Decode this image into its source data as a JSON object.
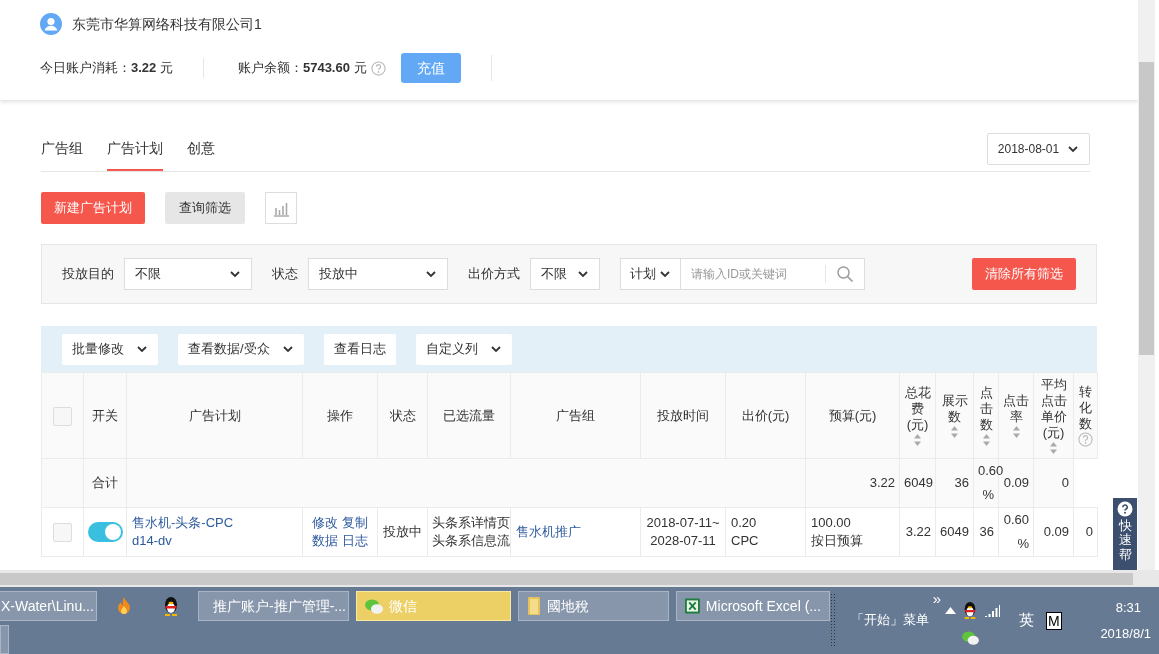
{
  "account": {
    "name": "东莞市华算网络科技有限公司1",
    "stats": [
      {
        "label": "今日账户消耗：",
        "value": "3.22",
        "unit": "元",
        "help": false
      },
      {
        "label": "账户余额：",
        "value": "5743.60",
        "unit": "元",
        "help": true
      }
    ],
    "recharge_button": "充值"
  },
  "tabs": [
    {
      "label": "广告组",
      "selected": false
    },
    {
      "label": "广告计划",
      "selected": true
    },
    {
      "label": "创意",
      "selected": false
    }
  ],
  "date_picker": {
    "value": "2018-08-01"
  },
  "actions": {
    "new_button": "新建广告计划",
    "filter_button": "查询筛选"
  },
  "filters": {
    "selects": [
      {
        "label": "投放目的",
        "value": "不限"
      },
      {
        "label": "状态",
        "value": "投放中"
      },
      {
        "label": "出价方式",
        "value": "不限"
      }
    ],
    "search": {
      "scope": "计划",
      "placeholder": "请输入ID或关键词"
    },
    "clear_button": "清除所有筛选"
  },
  "table": {
    "toolbar": [
      {
        "label": "批量修改",
        "dropdown": true
      },
      {
        "label": "查看数据/受众",
        "dropdown": true
      },
      {
        "label": "查看日志",
        "dropdown": false
      },
      {
        "label": "自定义列",
        "dropdown": true
      }
    ],
    "select_all": {
      "checked": false
    },
    "columns": [
      {
        "label": "开关",
        "sortable": false,
        "help": false
      },
      {
        "label": "广告计划",
        "sortable": false,
        "help": false
      },
      {
        "label": "操作",
        "sortable": false,
        "help": false
      },
      {
        "label": "状态",
        "sortable": false,
        "help": false
      },
      {
        "label": "已选流量",
        "sortable": false,
        "help": false
      },
      {
        "label": "广告组",
        "sortable": false,
        "help": false
      },
      {
        "label": "投放时间",
        "sortable": false,
        "help": false
      },
      {
        "label": "出价(元)",
        "sortable": false,
        "help": false
      },
      {
        "label": "预算(元)",
        "sortable": false,
        "help": false
      },
      {
        "label": "总花费(元)",
        "sortable": true,
        "help": false
      },
      {
        "label": "展示数",
        "sortable": true,
        "help": false
      },
      {
        "label": "点击数",
        "sortable": true,
        "help": false
      },
      {
        "label": "点击率",
        "sortable": true,
        "help": false
      },
      {
        "label": "平均点击单价(元)",
        "sortable": true,
        "help": false
      },
      {
        "label": "转化数",
        "sortable": false,
        "help": true
      }
    ],
    "total_row": {
      "label": "合计",
      "metrics": [
        "3.22",
        "6049",
        "36",
        "0.60 %",
        "0.09",
        "0"
      ]
    },
    "rows": [
      {
        "checked": false,
        "on": true,
        "plan": "售水机-头条-CPC d14-dv",
        "operations": [
          "修改",
          "复制",
          "数据",
          "日志"
        ],
        "status": "投放中",
        "traffic": [
          "头条系详情页",
          "头条系信息流"
        ],
        "group": "售水机推广",
        "time": [
          "2018-07-11~",
          "2028-07-11"
        ],
        "bid": [
          "0.20",
          "CPC"
        ],
        "budget": [
          "100.00",
          "按日预算"
        ],
        "metrics": [
          "3.22",
          "6049",
          "36",
          "0.60 %",
          "0.09",
          "0"
        ]
      }
    ]
  },
  "help_tab": "快速帮",
  "taskbar": {
    "items": [
      {
        "kind": "window",
        "label": "X-Water\\Linu...",
        "flashing": false
      },
      {
        "kind": "launcher"
      },
      {
        "kind": "launcher"
      },
      {
        "kind": "window",
        "label": "推广账户-推广管理-...",
        "flashing": false
      },
      {
        "kind": "window",
        "label": "微信",
        "flashing": true
      },
      {
        "kind": "window",
        "label": "國地稅",
        "flashing": false
      },
      {
        "kind": "window",
        "label": "Microsoft Excel (...",
        "flashing": false
      }
    ],
    "overflow": "»",
    "start_menu": "「开始」菜单",
    "ime": [
      "英",
      "M"
    ],
    "time": "8:31",
    "date": "2018/8/1"
  }
}
